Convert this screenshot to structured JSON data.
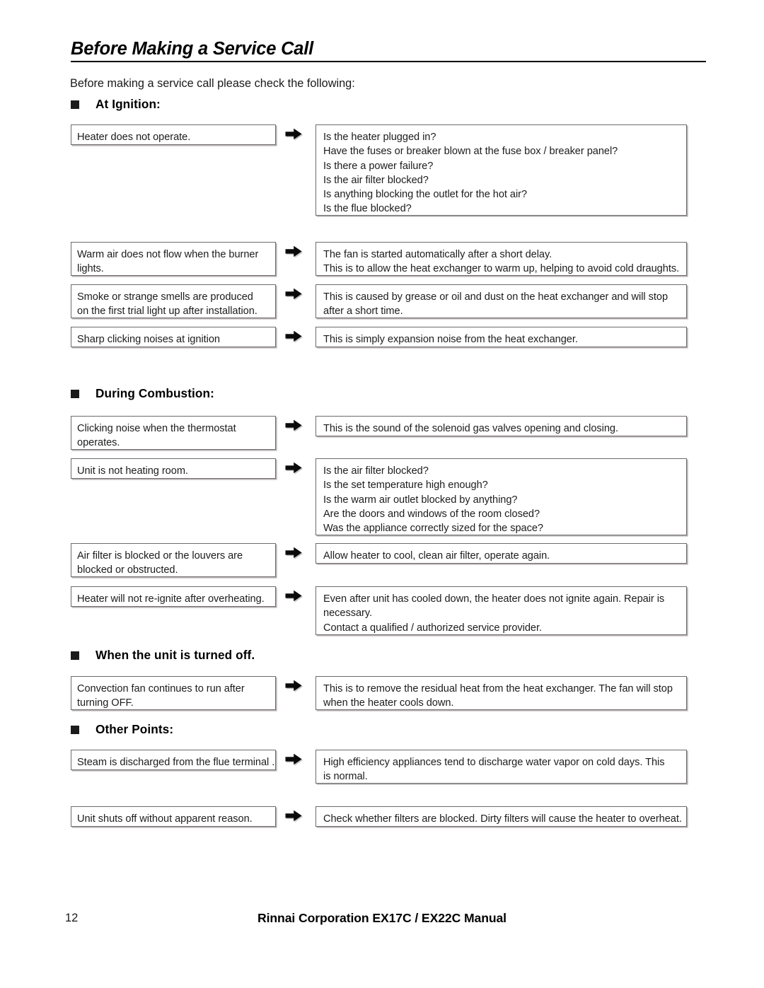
{
  "document": {
    "title": "Before Making a Service Call",
    "intro": "Before making a service call please check the following:"
  },
  "icons": {
    "bullet": "black-square-bullet",
    "arrow": "right-arrow-icon"
  },
  "sections": [
    {
      "id": "at-ignition",
      "heading": "At Ignition:",
      "rows": [
        {
          "problem": [
            "Heater does not operate."
          ],
          "answer": [
            "Is the heater plugged in?",
            "Have the fuses or breaker blown at the fuse box / breaker panel?",
            "Is there a power failure?",
            "Is the air filter blocked?",
            "Is anything blocking the outlet for the hot air?",
            "Is the flue blocked?"
          ]
        },
        {
          "problem": [
            "Warm air does not flow when the burner",
            "lights."
          ],
          "answer": [
            "The fan is started automatically after a short delay.",
            "This is to allow the heat exchanger to warm up, helping to avoid cold draughts."
          ]
        },
        {
          "problem": [
            "Smoke or strange smells are produced",
            "on the first trial light up after installation."
          ],
          "answer": [
            "This is caused by grease or oil and dust on the heat exchanger and will stop",
            "after a short time."
          ]
        },
        {
          "problem": [
            "Sharp clicking noises at ignition"
          ],
          "answer": [
            "This is simply expansion noise from the heat exchanger."
          ]
        }
      ]
    },
    {
      "id": "during-combustion",
      "heading": "During Combustion:",
      "rows": [
        {
          "problem": [
            "Clicking noise when the thermostat",
            "operates."
          ],
          "answer": [
            "This is the sound of the solenoid gas valves opening and closing."
          ]
        },
        {
          "problem": [
            "Unit is not heating room."
          ],
          "answer": [
            "Is the air filter blocked?",
            "Is the set temperature high enough?",
            "Is the warm air outlet blocked by anything?",
            "Are the doors and windows of the room closed?",
            "Was the appliance correctly sized for the space?"
          ]
        },
        {
          "problem": [
            "Air filter is blocked or the louvers are",
            "blocked or obstructed."
          ],
          "answer": [
            "Allow heater to cool, clean air filter, operate again."
          ]
        },
        {
          "problem": [
            "Heater will not re-ignite after overheating."
          ],
          "answer": [
            "Even after unit has cooled down, the heater does not ignite again.  Repair is",
            "necessary.",
            "Contact a qualified / authorized service provider."
          ]
        }
      ]
    },
    {
      "id": "when-turned-off",
      "heading": "When the unit is turned off.",
      "rows": [
        {
          "problem": [
            "Convection fan continues to run after",
            "turning OFF."
          ],
          "answer": [
            "This is to remove the residual heat from the heat exchanger.  The fan will stop",
            "when the heater cools down."
          ]
        }
      ]
    },
    {
      "id": "other-points",
      "heading": "Other Points:",
      "rows": [
        {
          "problem": [
            "Steam is discharged from the flue terminal ."
          ],
          "answer": [
            "High efficiency appliances tend to discharge water vapor on cold days.  This",
            "is normal."
          ]
        },
        {
          "problem": [
            "Unit shuts off without apparent reason."
          ],
          "answer": [
            "Check whether filters are blocked.  Dirty filters will cause the heater to overheat."
          ]
        }
      ]
    }
  ],
  "footer": {
    "page_number": "12",
    "manual_title": "Rinnai Corporation EX17C / EX22C Manual"
  }
}
